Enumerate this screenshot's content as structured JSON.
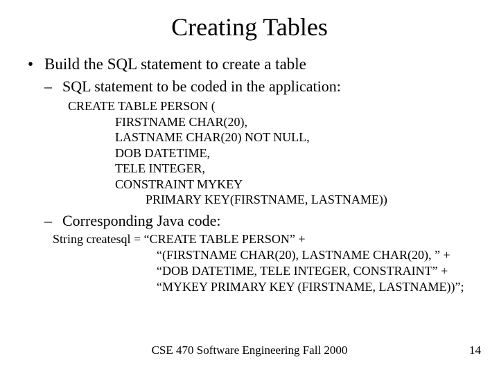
{
  "title": "Creating Tables",
  "bullet1": {
    "marker": "•",
    "text": "Build the SQL statement to create a table"
  },
  "sub1": {
    "marker": "–",
    "text": "SQL statement to be coded in the application:"
  },
  "sql": {
    "l1": "CREATE TABLE PERSON (",
    "l2": "FIRSTNAME CHAR(20),",
    "l3": "LASTNAME CHAR(20)  NOT NULL,",
    "l4": "DOB DATETIME,",
    "l5": "TELE INTEGER,",
    "l6": "CONSTRAINT MYKEY",
    "l7": "PRIMARY KEY(FIRSTNAME, LASTNAME))"
  },
  "sub2": {
    "marker": "–",
    "text": "Corresponding Java code:"
  },
  "java": {
    "l1": "String createsql = “CREATE TABLE PERSON” +",
    "l2": "“(FIRSTNAME CHAR(20), LASTNAME CHAR(20), ” +",
    "l3": "“DOB DATETIME, TELE INTEGER, CONSTRAINT” +",
    "l4": "“MYKEY PRIMARY KEY (FIRSTNAME, LASTNAME))”;"
  },
  "footer": "CSE 470    Software Engineering    Fall 2000",
  "page": "14"
}
